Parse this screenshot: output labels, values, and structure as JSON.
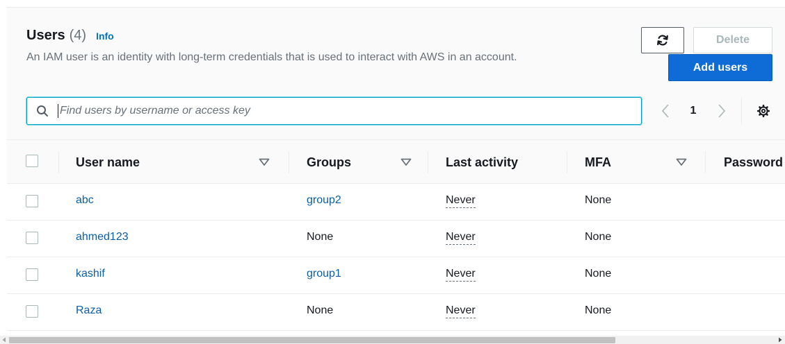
{
  "header": {
    "title": "Users",
    "count": "(4)",
    "info_label": "Info",
    "description": "An IAM user is an identity with long-term credentials that is used to interact with AWS in an account."
  },
  "actions": {
    "refresh_icon": "refresh-icon",
    "delete_label": "Delete",
    "add_label": "Add users"
  },
  "search": {
    "placeholder": "Find users by username or access key",
    "value": "",
    "icon": "search-icon"
  },
  "pagination": {
    "current_page": "1",
    "prev_icon": "chevron-left-icon",
    "next_icon": "chevron-right-icon",
    "settings_icon": "gear-icon"
  },
  "table": {
    "columns": [
      {
        "label": "User name",
        "sortable": true
      },
      {
        "label": "Groups",
        "sortable": true
      },
      {
        "label": "Last activity",
        "sortable": false
      },
      {
        "label": "MFA",
        "sortable": true
      },
      {
        "label": "Password",
        "sortable": false
      }
    ],
    "rows": [
      {
        "user": "abc",
        "groups": "group2",
        "groups_is_link": true,
        "last_activity": "Never",
        "mfa": "None"
      },
      {
        "user": "ahmed123",
        "groups": "None",
        "groups_is_link": false,
        "last_activity": "Never",
        "mfa": "None"
      },
      {
        "user": "kashif",
        "groups": "group1",
        "groups_is_link": true,
        "last_activity": "Never",
        "mfa": "None"
      },
      {
        "user": "Raza",
        "groups": "None",
        "groups_is_link": false,
        "last_activity": "Never",
        "mfa": "None"
      }
    ]
  },
  "colors": {
    "primary": "#0f6bd6",
    "link": "#0a5ea8",
    "info_link": "#0073bb",
    "search_focus": "#00a1c9"
  }
}
